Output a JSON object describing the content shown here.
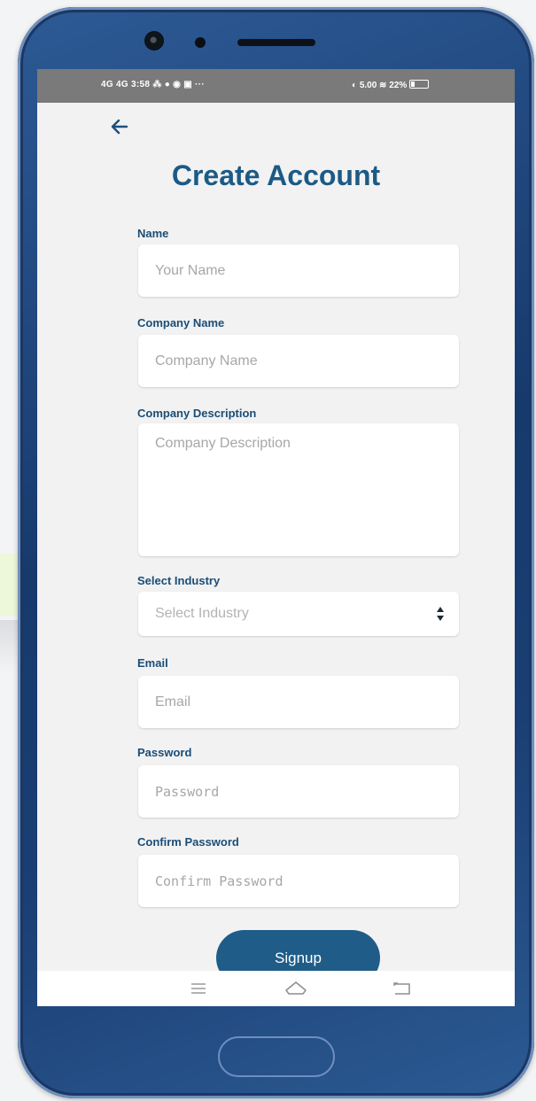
{
  "status_bar": {
    "left_text": "4G 4G 3:58 ⁂ ● ◉ ▣ ···",
    "right_text": "◐ 5.00 ≋ 22%"
  },
  "form": {
    "title": "Create Account",
    "name": {
      "label": "Name",
      "placeholder": "Your Name",
      "value": ""
    },
    "company_name": {
      "label": "Company Name",
      "placeholder": "Company Name",
      "value": ""
    },
    "company_description": {
      "label": "Company Description",
      "placeholder": "Company Description",
      "value": ""
    },
    "industry": {
      "label": "Select Industry",
      "selected": "Select Industry"
    },
    "email": {
      "label": "Email",
      "placeholder": "Email",
      "value": ""
    },
    "password": {
      "label": "Password",
      "placeholder": "Password",
      "value": ""
    },
    "confirm_password": {
      "label": "Confirm Password",
      "placeholder": "Confirm Password",
      "value": ""
    },
    "submit_label": "Signup"
  },
  "icons": {
    "back": "back-arrow-icon",
    "select": "select-arrows-icon",
    "menu": "recent-apps-icon",
    "home": "home-icon",
    "back_nav": "back-icon"
  },
  "colors": {
    "accent": "#1f5d88",
    "title": "#1c5a86",
    "label": "#1a4d77",
    "phone_body": "#1a3f74",
    "status_bar": "#7a7a7a"
  }
}
